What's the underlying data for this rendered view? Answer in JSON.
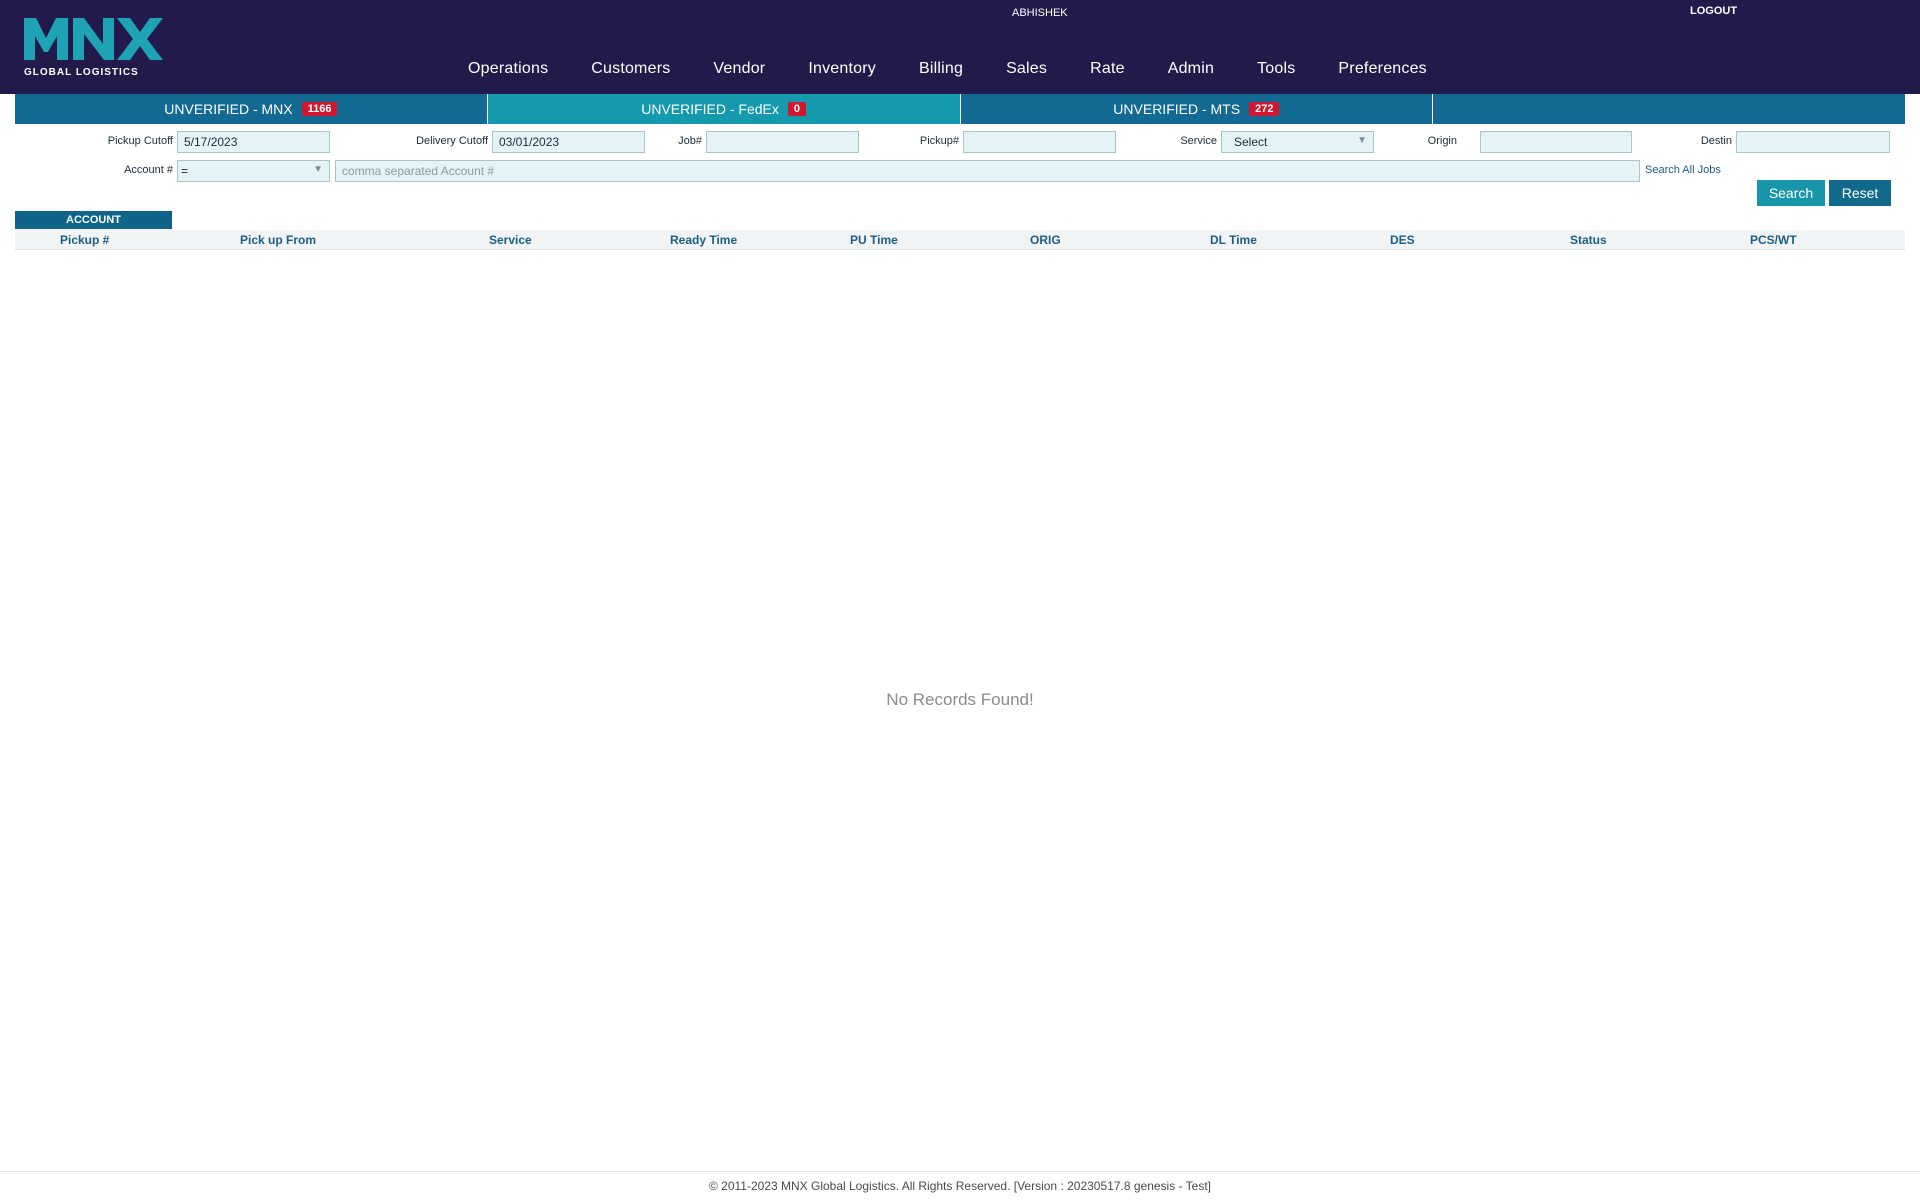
{
  "header": {
    "logo_text": "MNX",
    "logo_subtitle": "GLOBAL LOGISTICS",
    "username": "ABHISHEK",
    "logout_label": "LOGOUT",
    "nav": [
      "Operations",
      "Customers",
      "Vendor",
      "Inventory",
      "Billing",
      "Sales",
      "Rate",
      "Admin",
      "Tools",
      "Preferences"
    ]
  },
  "tabs": [
    {
      "label": "UNVERIFIED - MNX",
      "count": "1166",
      "active": false
    },
    {
      "label": "UNVERIFIED - FedEx",
      "count": "0",
      "active": true
    },
    {
      "label": "UNVERIFIED - MTS",
      "count": "272",
      "active": false
    },
    {
      "label": "",
      "count": "",
      "active": false
    }
  ],
  "filters": {
    "pickup_cutoff": {
      "label": "Pickup Cutoff",
      "value": "5/17/2023"
    },
    "delivery_cutoff": {
      "label": "Delivery Cutoff",
      "value": "03/01/2023"
    },
    "job": {
      "label": "Job#",
      "value": ""
    },
    "pickup": {
      "label": "Pickup#",
      "value": ""
    },
    "service": {
      "label": "Service",
      "value": "Select"
    },
    "origin": {
      "label": "Origin",
      "value": ""
    },
    "destin": {
      "label": "Destin",
      "value": ""
    },
    "account": {
      "label": "Account #",
      "operator": "=",
      "placeholder": "comma separated Account #"
    },
    "search_all_label": "Search All Jobs",
    "search_label": "Search",
    "reset_label": "Reset"
  },
  "grid": {
    "group_tab": "ACCOUNT",
    "columns": [
      "Pickup #",
      "Pick up From",
      "Service",
      "Ready Time",
      "PU Time",
      "ORIG",
      "DL Time",
      "DES",
      "Status",
      "PCS/WT"
    ],
    "empty_message": "No Records Found!"
  },
  "footer": {
    "text": "© 2011-2023 MNX Global Logistics. All Rights Reserved. [Version : 20230517.8 genesis - Test]"
  },
  "colors": {
    "header_bg": "#221a4a",
    "tab_bg": "#126a92",
    "tab_active_bg": "#1599ac",
    "badge_bg": "#d0172f",
    "logo_teal": "#1da3b4"
  }
}
